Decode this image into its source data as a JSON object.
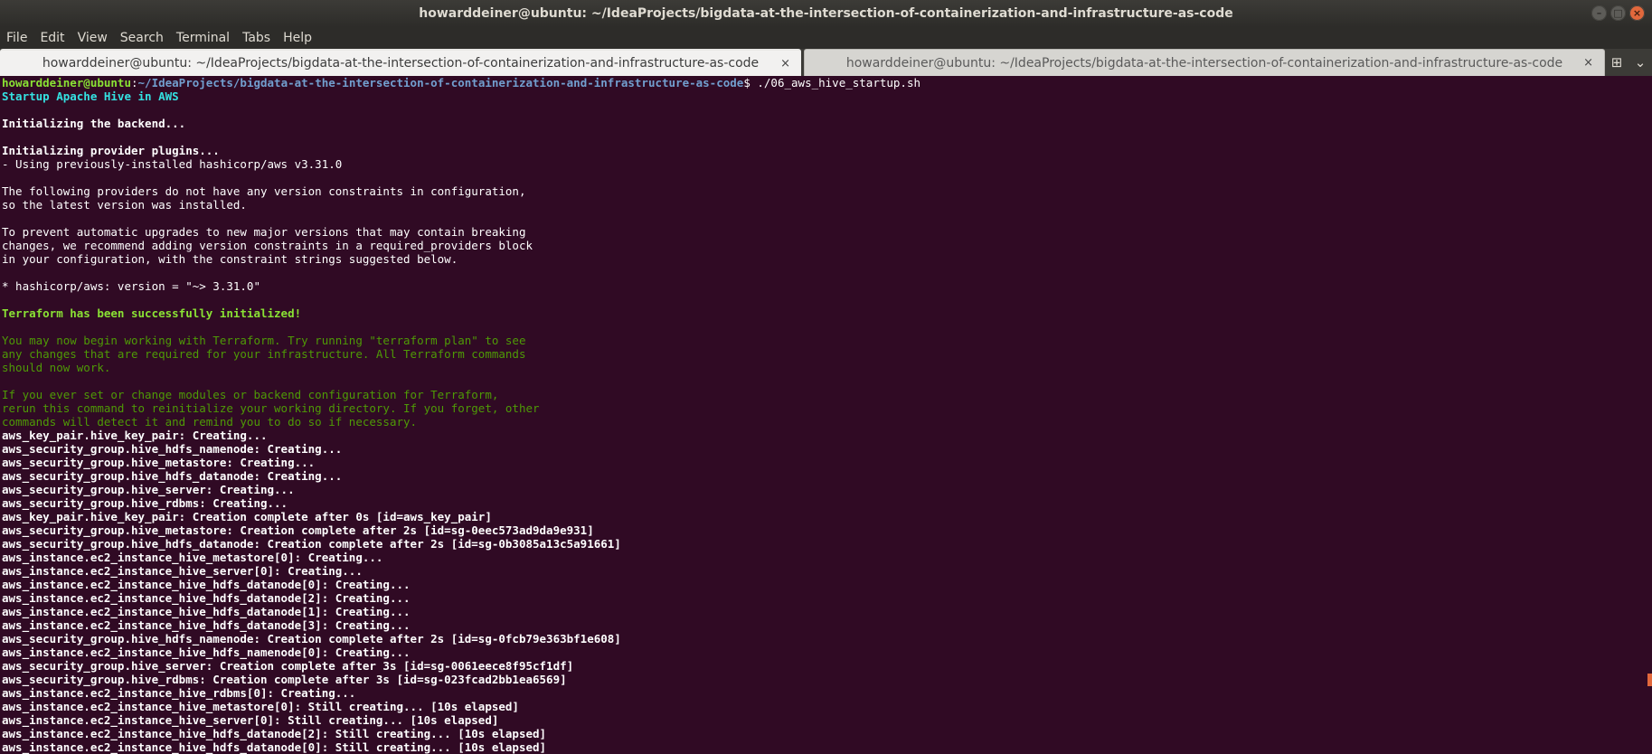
{
  "window": {
    "title": "howarddeiner@ubuntu: ~/IdeaProjects/bigdata-at-the-intersection-of-containerization-and-infrastructure-as-code",
    "minimize_glyph": "–",
    "maximize_glyph": "□",
    "close_glyph": "×"
  },
  "menu": {
    "file": "File",
    "edit": "Edit",
    "view": "View",
    "search": "Search",
    "terminal": "Terminal",
    "tabs": "Tabs",
    "help": "Help"
  },
  "tabs": [
    {
      "label": "howarddeiner@ubuntu: ~/IdeaProjects/bigdata-at-the-intersection-of-containerization-and-infrastructure-as-code",
      "close": "×"
    },
    {
      "label": "howarddeiner@ubuntu: ~/IdeaProjects/bigdata-at-the-intersection-of-containerization-and-infrastructure-as-code",
      "close": "×"
    }
  ],
  "tab_tools": {
    "new_tab_icon": "new-tab-icon",
    "new_tab_glyph": "⊞",
    "tab_list_icon": "tab-list-icon",
    "tab_list_glyph": "⌄"
  },
  "prompt": {
    "user": "howarddeiner@ubuntu",
    "sep": ":",
    "path": "~/IdeaProjects/bigdata-at-the-intersection-of-containerization-and-infrastructure-as-code",
    "symbol": "$",
    "command": " ./06_aws_hive_startup.sh"
  },
  "output": [
    {
      "text": "Startup Apache Hive in AWS",
      "style": "cyan b"
    },
    {
      "text": "",
      "style": ""
    },
    {
      "text": "Initializing the backend...",
      "style": "b"
    },
    {
      "text": "",
      "style": ""
    },
    {
      "text": "Initializing provider plugins...",
      "style": "b"
    },
    {
      "text": "- Using previously-installed hashicorp/aws v3.31.0",
      "style": ""
    },
    {
      "text": "",
      "style": ""
    },
    {
      "text": "The following providers do not have any version constraints in configuration,",
      "style": ""
    },
    {
      "text": "so the latest version was installed.",
      "style": ""
    },
    {
      "text": "",
      "style": ""
    },
    {
      "text": "To prevent automatic upgrades to new major versions that may contain breaking",
      "style": ""
    },
    {
      "text": "changes, we recommend adding version constraints in a required_providers block",
      "style": ""
    },
    {
      "text": "in your configuration, with the constraint strings suggested below.",
      "style": ""
    },
    {
      "text": "",
      "style": ""
    },
    {
      "text": "* hashicorp/aws: version = \"~> 3.31.0\"",
      "style": ""
    },
    {
      "text": "",
      "style": ""
    },
    {
      "text": "Terraform has been successfully initialized!",
      "style": "green b"
    },
    {
      "text": "",
      "style": ""
    },
    {
      "text": "You may now begin working with Terraform. Try running \"terraform plan\" to see",
      "style": "dgreen"
    },
    {
      "text": "any changes that are required for your infrastructure. All Terraform commands",
      "style": "dgreen"
    },
    {
      "text": "should now work.",
      "style": "dgreen"
    },
    {
      "text": "",
      "style": ""
    },
    {
      "text": "If you ever set or change modules or backend configuration for Terraform,",
      "style": "dgreen"
    },
    {
      "text": "rerun this command to reinitialize your working directory. If you forget, other",
      "style": "dgreen"
    },
    {
      "text": "commands will detect it and remind you to do so if necessary.",
      "style": "dgreen"
    },
    {
      "text": "aws_key_pair.hive_key_pair: Creating...",
      "style": "b"
    },
    {
      "text": "aws_security_group.hive_hdfs_namenode: Creating...",
      "style": "b"
    },
    {
      "text": "aws_security_group.hive_metastore: Creating...",
      "style": "b"
    },
    {
      "text": "aws_security_group.hive_hdfs_datanode: Creating...",
      "style": "b"
    },
    {
      "text": "aws_security_group.hive_server: Creating...",
      "style": "b"
    },
    {
      "text": "aws_security_group.hive_rdbms: Creating...",
      "style": "b"
    },
    {
      "text": "aws_key_pair.hive_key_pair: Creation complete after 0s [id=aws_key_pair]",
      "style": "b"
    },
    {
      "text": "aws_security_group.hive_metastore: Creation complete after 2s [id=sg-0eec573ad9da9e931]",
      "style": "b"
    },
    {
      "text": "aws_security_group.hive_hdfs_datanode: Creation complete after 2s [id=sg-0b3085a13c5a91661]",
      "style": "b"
    },
    {
      "text": "aws_instance.ec2_instance_hive_metastore[0]: Creating...",
      "style": "b"
    },
    {
      "text": "aws_instance.ec2_instance_hive_server[0]: Creating...",
      "style": "b"
    },
    {
      "text": "aws_instance.ec2_instance_hive_hdfs_datanode[0]: Creating...",
      "style": "b"
    },
    {
      "text": "aws_instance.ec2_instance_hive_hdfs_datanode[2]: Creating...",
      "style": "b"
    },
    {
      "text": "aws_instance.ec2_instance_hive_hdfs_datanode[1]: Creating...",
      "style": "b"
    },
    {
      "text": "aws_instance.ec2_instance_hive_hdfs_datanode[3]: Creating...",
      "style": "b"
    },
    {
      "text": "aws_security_group.hive_hdfs_namenode: Creation complete after 2s [id=sg-0fcb79e363bf1e608]",
      "style": "b"
    },
    {
      "text": "aws_instance.ec2_instance_hive_hdfs_namenode[0]: Creating...",
      "style": "b"
    },
    {
      "text": "aws_security_group.hive_server: Creation complete after 3s [id=sg-0061eece8f95cf1df]",
      "style": "b"
    },
    {
      "text": "aws_security_group.hive_rdbms: Creation complete after 3s [id=sg-023fcad2bb1ea6569]",
      "style": "b"
    },
    {
      "text": "aws_instance.ec2_instance_hive_rdbms[0]: Creating...",
      "style": "b"
    },
    {
      "text": "aws_instance.ec2_instance_hive_metastore[0]: Still creating... [10s elapsed]",
      "style": "b"
    },
    {
      "text": "aws_instance.ec2_instance_hive_server[0]: Still creating... [10s elapsed]",
      "style": "b"
    },
    {
      "text": "aws_instance.ec2_instance_hive_hdfs_datanode[2]: Still creating... [10s elapsed]",
      "style": "b"
    },
    {
      "text": "aws_instance.ec2_instance_hive_hdfs_datanode[0]: Still creating... [10s elapsed]",
      "style": "b"
    }
  ]
}
